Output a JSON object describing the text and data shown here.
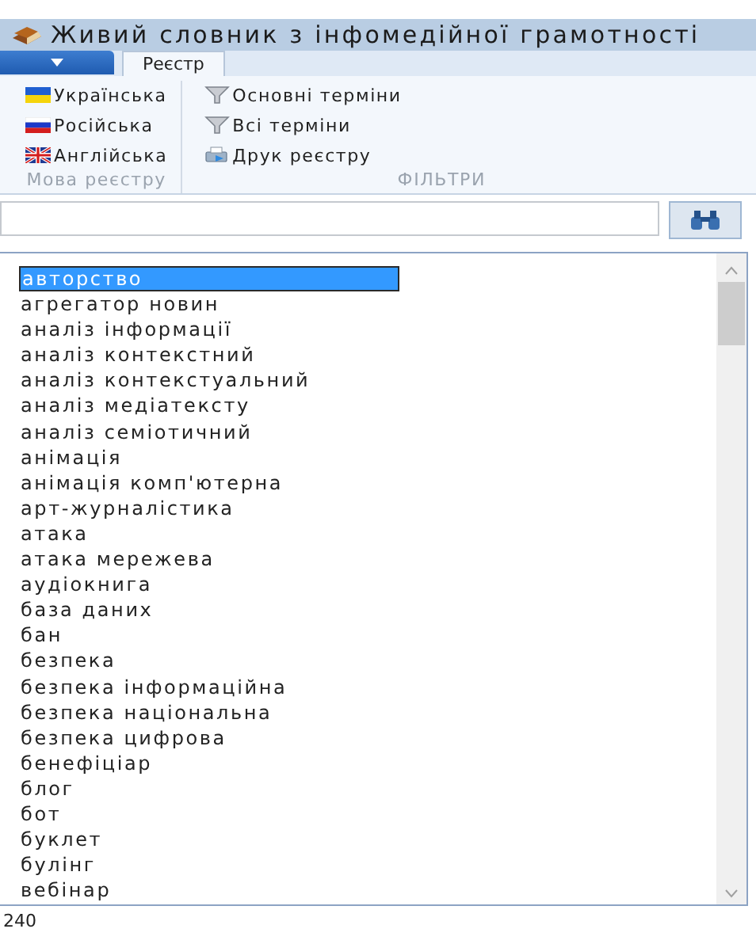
{
  "window": {
    "title": "Живий словник з інфомедійної грамотності"
  },
  "tabs": [
    {
      "label": "Реєстр",
      "selected": true
    }
  ],
  "ribbon": {
    "groups": [
      {
        "label": "Мова реєстру",
        "items": [
          {
            "label": "Українська"
          },
          {
            "label": "Російська"
          },
          {
            "label": "Англійська"
          }
        ]
      },
      {
        "label": "ФІЛЬТРИ",
        "items": [
          {
            "label": "Основні терміни"
          },
          {
            "label": "Всі терміни"
          },
          {
            "label": "Друк реєстру"
          }
        ]
      }
    ]
  },
  "terms": [
    {
      "label": "авторство",
      "selected": true
    },
    {
      "label": "агрегатор новин",
      "selected": false
    },
    {
      "label": "аналіз інформації",
      "selected": false
    },
    {
      "label": "аналіз контекстний",
      "selected": false
    },
    {
      "label": "аналіз контекстуальний",
      "selected": false
    },
    {
      "label": "аналіз медіатексту",
      "selected": false
    },
    {
      "label": "аналіз семіотичний",
      "selected": false
    },
    {
      "label": "анімація",
      "selected": false
    },
    {
      "label": "анімація комп'ютерна",
      "selected": false
    },
    {
      "label": "арт-журналістика",
      "selected": false
    },
    {
      "label": "атака",
      "selected": false
    },
    {
      "label": "атака мережева",
      "selected": false
    },
    {
      "label": "аудіокнига",
      "selected": false
    },
    {
      "label": "база даних",
      "selected": false
    },
    {
      "label": "бан",
      "selected": false
    },
    {
      "label": "безпека",
      "selected": false
    },
    {
      "label": "безпека інформаційна",
      "selected": false
    },
    {
      "label": "безпека національна",
      "selected": false
    },
    {
      "label": "безпека цифрова",
      "selected": false
    },
    {
      "label": "бенефіціар",
      "selected": false
    },
    {
      "label": "блог",
      "selected": false
    },
    {
      "label": "бот",
      "selected": false
    },
    {
      "label": "буклет",
      "selected": false
    },
    {
      "label": "булінг",
      "selected": false
    },
    {
      "label": "вебінар",
      "selected": false
    }
  ],
  "status_bar": {
    "count": "240"
  }
}
